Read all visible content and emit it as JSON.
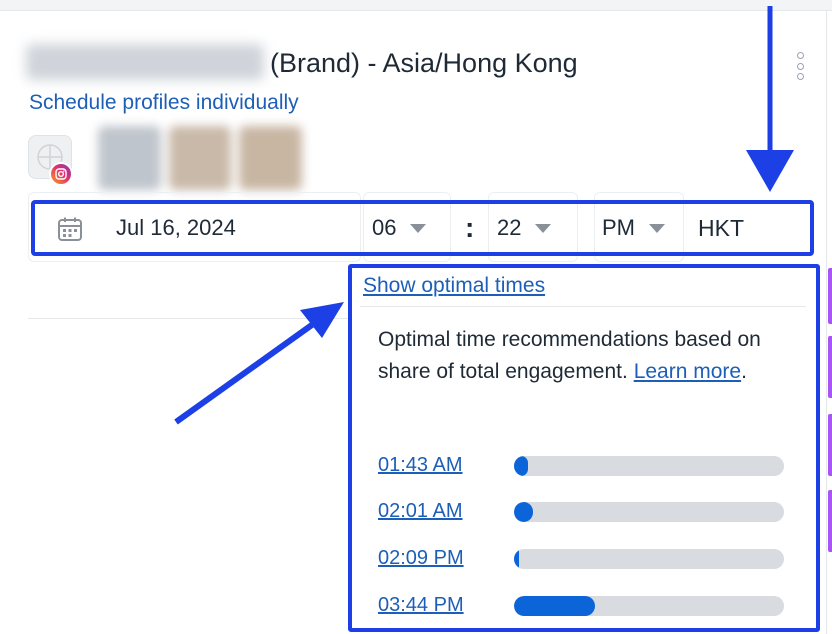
{
  "header": {
    "account_suffix": "(Brand) - Asia/Hong Kong",
    "schedule_link": "Schedule profiles individually"
  },
  "schedule": {
    "date": "Jul 16, 2024",
    "hour": "06",
    "separator": ":",
    "minute": "22",
    "ampm": "PM",
    "timezone": "HKT"
  },
  "optimal": {
    "toggle_label": "Show optimal times",
    "description": "Optimal time recommendations based on share of total engagement.",
    "learn_more": "Learn more",
    "learn_more_suffix": ".",
    "times": [
      {
        "label": "01:43 AM",
        "share": 0.05
      },
      {
        "label": "02:01 AM",
        "share": 0.07
      },
      {
        "label": "02:09 PM",
        "share": 0.02
      },
      {
        "label": "03:44 PM",
        "share": 0.3
      }
    ]
  },
  "colors": {
    "accent_link": "#1d5fb8",
    "highlight_border": "#1c3fe6",
    "bar_fill": "#0b64d8",
    "bar_track": "#d8dbdf",
    "side_accent": "#a855f7"
  },
  "icons": {
    "calendar": "calendar-icon",
    "instagram": "instagram-icon",
    "more": "more-vertical-icon",
    "dropdown": "chevron-down-icon"
  }
}
